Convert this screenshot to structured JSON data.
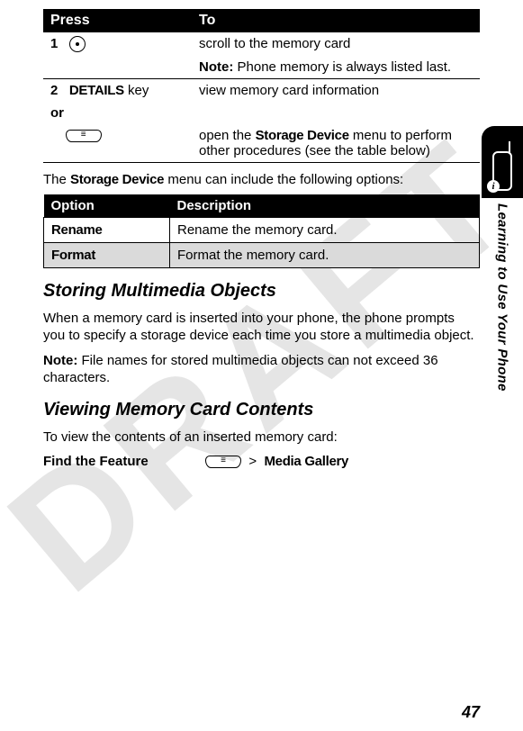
{
  "watermark": "DRAFT",
  "press_table": {
    "headers": [
      "Press",
      "To"
    ],
    "rows": [
      {
        "step": "1",
        "press_icon": "dpad-icon",
        "to": "scroll to the memory card",
        "note_label": "Note:",
        "note": "Phone memory is always listed last."
      },
      {
        "step": "2",
        "press": "DETAILS",
        "press_suffix": " key",
        "to": "view memory card information"
      },
      {
        "or": "or"
      },
      {
        "press_icon": "menu-key-icon",
        "to_part1": "open the ",
        "to_bold": "Storage Device",
        "to_part2": " menu to perform other procedures (see the table below)"
      }
    ]
  },
  "para1_a": "The ",
  "para1_b": "Storage Device",
  "para1_c": " menu can include the following options:",
  "option_table": {
    "headers": [
      "Option",
      "Description"
    ],
    "rows": [
      {
        "opt": "Rename",
        "desc": "Rename the memory card."
      },
      {
        "opt": "Format",
        "desc": "Format the memory card."
      }
    ]
  },
  "section1": {
    "title": "Storing Multimedia Objects",
    "p1": "When a memory card is inserted into your phone, the phone prompts you to specify a storage device each time you store a multimedia object.",
    "note_label": "Note:",
    "note": "File names for stored multimedia objects can not exceed 36 characters."
  },
  "section2": {
    "title": "Viewing Memory Card Contents",
    "p1": "To view the contents of an inserted memory card:"
  },
  "find": {
    "label": "Find the Feature",
    "arrow": ">",
    "target": "Media Gallery"
  },
  "side_label": "Learning to Use Your Phone",
  "page_number": "47"
}
